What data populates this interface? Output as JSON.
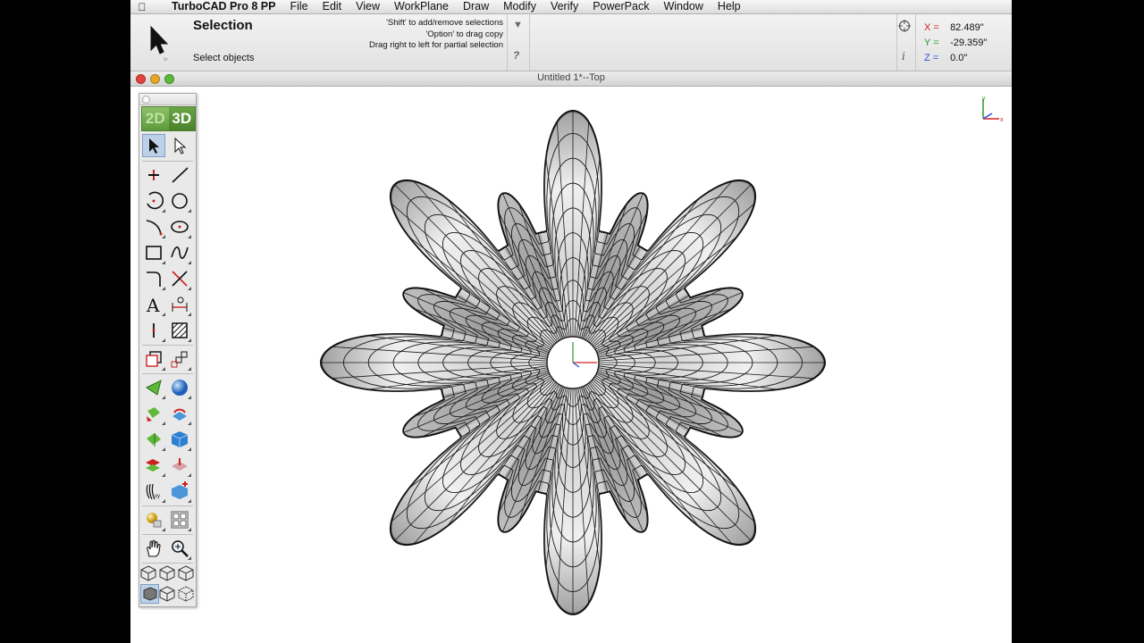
{
  "menubar": {
    "apple_icon": "apple-icon",
    "app_name": "TurboCAD Pro 8 PP",
    "items": [
      "File",
      "Edit",
      "View",
      "WorkPlane",
      "Draw",
      "Modify",
      "Verify",
      "PowerPack",
      "Window",
      "Help"
    ]
  },
  "inspector": {
    "tool_icon": "arrow-cursor-icon",
    "tool_name": "Selection",
    "prompt": "Select objects",
    "hints": [
      "'Shift' to add/remove selections",
      "'Option' to drag copy",
      "Drag right to left for partial selection"
    ],
    "help_label": "?",
    "info_label": "i",
    "coords": {
      "x_label": "X =",
      "x_value": "82.489\"",
      "y_label": "Y =",
      "y_value": "-29.359\"",
      "z_label": "Z =",
      "z_value": "0.0\""
    }
  },
  "window": {
    "title": "Untitled 1*--Top"
  },
  "palette": {
    "mode_2d": "2D",
    "mode_3d": "3D",
    "tools": [
      "select-arrow-icon",
      "node-edit-arrow-icon",
      "point-icon",
      "line-icon",
      "arc-icon",
      "circle-icon",
      "curve-icon",
      "ellipse-icon",
      "rectangle-icon",
      "spline-icon",
      "fillet-icon",
      "trim-icon",
      "text-icon",
      "dimension-icon",
      "insert-icon",
      "hatch-icon",
      "copy-icon",
      "array-icon",
      "cone-icon",
      "sphere-icon",
      "extrude-icon",
      "revolve-icon",
      "loft-icon",
      "box-icon",
      "boolean-add-icon",
      "boolean-subtract-icon",
      "surface-icon",
      "solid-edit-icon",
      "material-icon",
      "render-icon",
      "pan-hand-icon",
      "zoom-icon",
      "view-iso-1-icon",
      "view-iso-2-icon",
      "view-iso-3-icon",
      "shaded-view-icon",
      "wireframe-view-icon",
      "hidden-line-view-icon"
    ]
  },
  "viewport": {
    "axis_x_label": "x",
    "axis_y_label": "y",
    "model": "flower-surface-mesh"
  },
  "colors": {
    "x_axis": "#d62020",
    "y_axis": "#2a9a2a",
    "z_axis": "#2a4fd6",
    "mode_green": "#5d9a3a",
    "selected_tool": "#bcd0e8"
  }
}
